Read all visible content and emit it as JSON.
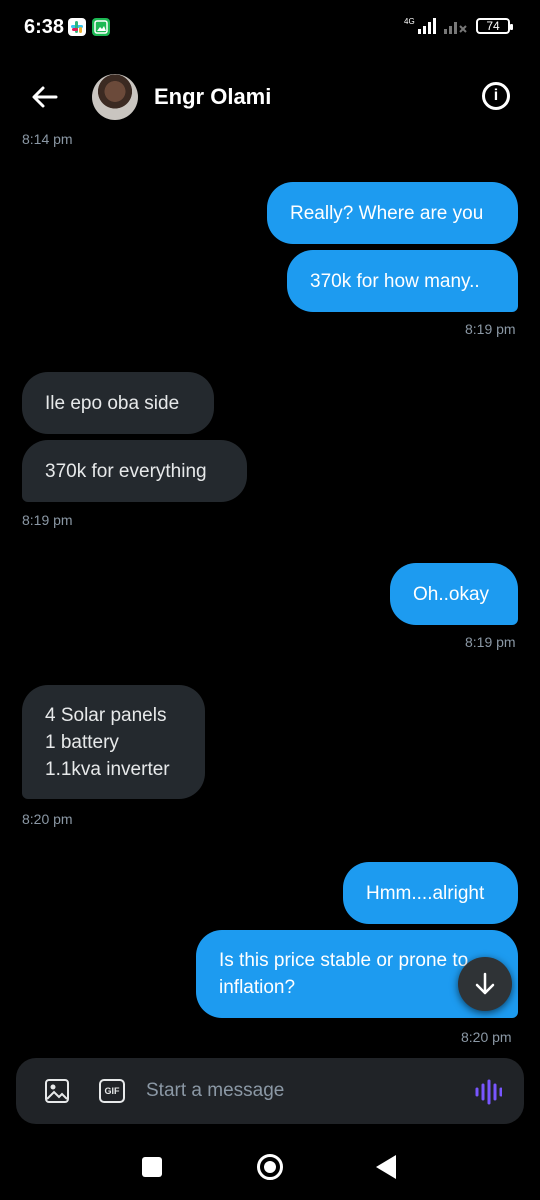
{
  "status_bar": {
    "time": "6:38",
    "network": "4G",
    "battery": "74"
  },
  "header": {
    "contact_name": "Engr Olami"
  },
  "messages": {
    "ts_top": "8:14 pm",
    "m1": "Really? Where are you",
    "m2": "370k for how many..",
    "ts1": "8:19 pm",
    "m3": "Ile epo oba side",
    "m4": "370k for everything",
    "ts2": "8:19 pm",
    "m5": "Oh..okay",
    "ts3": "8:19 pm",
    "m6": "4 Solar panels\n1 battery\n1.1kva inverter",
    "ts4": "8:20 pm",
    "m7": "Hmm....alright",
    "m8": "Is this price stable or prone to\ninflation?",
    "ts5": "8:20 pm"
  },
  "composer": {
    "placeholder": "Start a message",
    "gif_label": "GIF"
  },
  "colors": {
    "outgoing": "#1d9bf0",
    "incoming": "#24292e",
    "voice": "#7856ff"
  }
}
